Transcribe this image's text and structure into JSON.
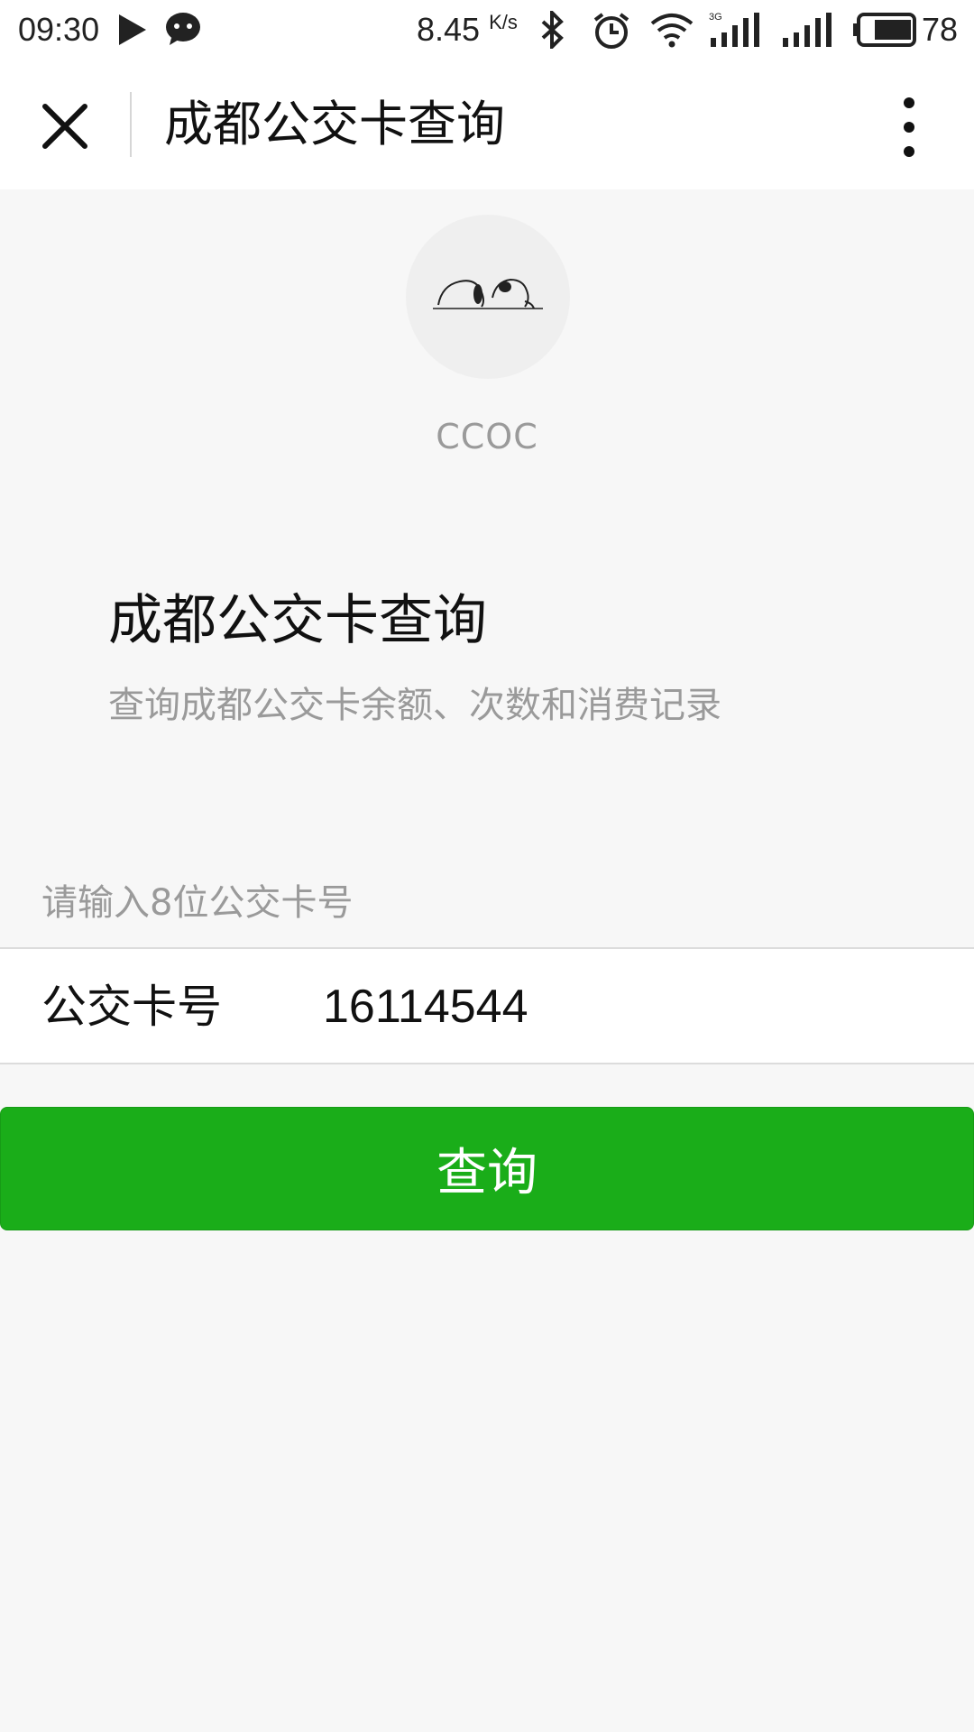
{
  "status_bar": {
    "time": "09:30",
    "speed": "8.45",
    "speed_unit": "K/s",
    "battery": "78"
  },
  "nav": {
    "title": "成都公交卡查询"
  },
  "profile": {
    "name": "CCOC"
  },
  "page": {
    "title": "成都公交卡查询",
    "description": "查询成都公交卡余额、次数和消费记录"
  },
  "form": {
    "hint": "请输入8位公交卡号",
    "card_label": "公交卡号",
    "card_value": "16114544"
  },
  "actions": {
    "query_label": "查询"
  },
  "colors": {
    "accent": "#1aad19",
    "background": "#f7f7f7"
  }
}
